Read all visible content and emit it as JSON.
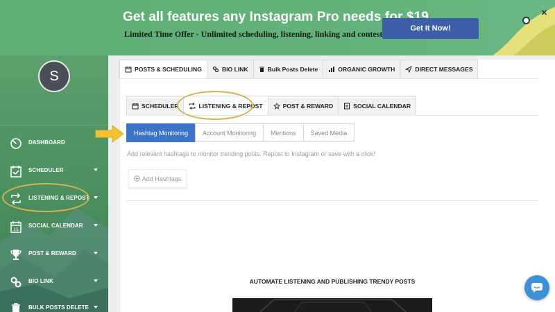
{
  "banner": {
    "title": "Get all features any Instagram Pro needs for $19",
    "subtitle": "Limited Time Offer - Unlimited scheduling, listening, linking and contests",
    "cta": "Get It Now!",
    "close": "×"
  },
  "user": {
    "initial": "S"
  },
  "sidebar": {
    "items": [
      {
        "label": "DASHBOARD",
        "icon": "gauge-icon"
      },
      {
        "label": "SCHEDULER",
        "icon": "calendar-check-icon"
      },
      {
        "label": "LISTENING & REPOST",
        "icon": "repost-icon"
      },
      {
        "label": "SOCIAL CALENDAR",
        "icon": "calendar-15-icon"
      },
      {
        "label": "POST & REWARD",
        "icon": "trophy-icon"
      },
      {
        "label": "BIO LINK",
        "icon": "link-icon"
      },
      {
        "label": "BULK POSTS DELETE",
        "icon": "trash-icon"
      }
    ],
    "calendar_day": "15"
  },
  "main_tabs": [
    {
      "label": "POSTS & SCHEDULING",
      "icon": "calendar-icon",
      "active": true
    },
    {
      "label": "BIO LINK",
      "icon": "link-icon"
    },
    {
      "label": "Bulk Posts Delete",
      "icon": "trash-icon"
    },
    {
      "label": "ORGANIC GROWTH",
      "icon": "bar-chart-icon"
    },
    {
      "label": "DIRECT MESSAGES",
      "icon": "send-icon"
    }
  ],
  "sub_tabs": [
    {
      "label": "SCHEDULER",
      "icon": "calendar-icon"
    },
    {
      "label": "LISTENING & REPOST",
      "icon": "repost-icon",
      "active": true
    },
    {
      "label": "POST & REWARD",
      "icon": "star-icon"
    },
    {
      "label": "SOCIAL CALENDAR",
      "icon": "calendar-icon"
    }
  ],
  "monitor_tabs": [
    {
      "label": "Hashtag Monitoring",
      "active": true
    },
    {
      "label": "Account Monitoring"
    },
    {
      "label": "Mentions"
    },
    {
      "label": "Saved Media"
    }
  ],
  "help_text": "Add relevant hashtags to monitor trending posts. Repost to Instagram or save with a click!",
  "add_button": "Add Hashtags",
  "section_title": "AUTOMATE LISTENING AND PUBLISHING TRENDY POSTS",
  "colors": {
    "accent": "#3b74c9",
    "highlight": "#d4b24f",
    "sidebar": "#4f9362",
    "banner": "#62b27a",
    "cta": "#3f5ea8"
  }
}
